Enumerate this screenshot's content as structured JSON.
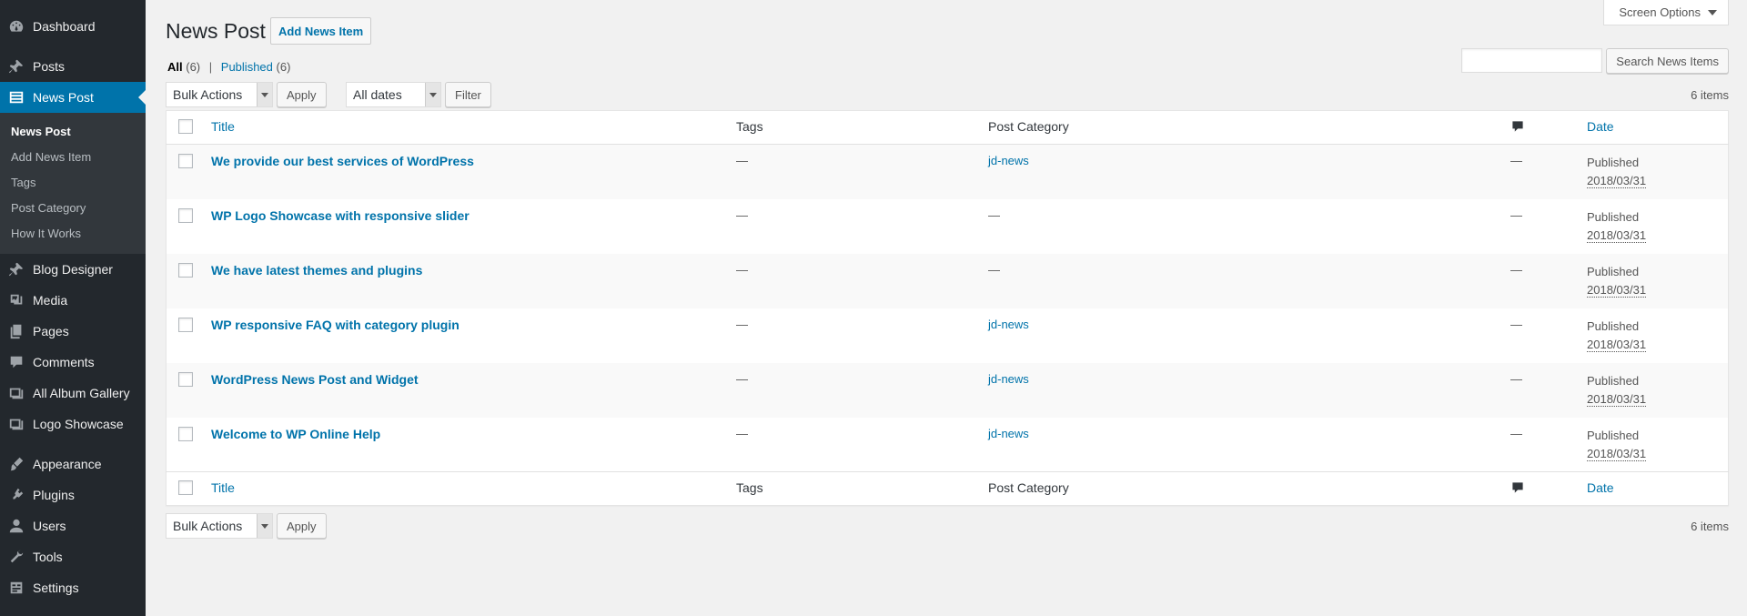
{
  "sidebar": {
    "items_top": [
      {
        "label": "Dashboard",
        "icon": "dashboard-icon"
      },
      {
        "label": "Posts",
        "icon": "pin-icon"
      }
    ],
    "current": {
      "label": "News Post",
      "icon": "list-icon"
    },
    "submenu": [
      "News Post",
      "Add News Item",
      "Tags",
      "Post Category",
      "How It Works"
    ],
    "items_mid": [
      {
        "label": "Blog Designer",
        "icon": "pin-icon"
      },
      {
        "label": "Media",
        "icon": "media-icon"
      },
      {
        "label": "Pages",
        "icon": "pages-icon"
      },
      {
        "label": "Comments",
        "icon": "comment-icon"
      },
      {
        "label": "All Album Gallery",
        "icon": "gallery-icon"
      },
      {
        "label": "Logo Showcase",
        "icon": "gallery-icon"
      }
    ],
    "items_bottom": [
      {
        "label": "Appearance",
        "icon": "brush-icon"
      },
      {
        "label": "Plugins",
        "icon": "plugin-icon"
      },
      {
        "label": "Users",
        "icon": "user-icon"
      },
      {
        "label": "Tools",
        "icon": "wrench-icon"
      },
      {
        "label": "Settings",
        "icon": "settings-icon"
      }
    ]
  },
  "header": {
    "screen_options": "Screen Options",
    "title": "News Post",
    "add_button": "Add News Item"
  },
  "filters": {
    "all_label": "All",
    "all_count": "(6)",
    "published_label": "Published",
    "published_count": "(6)",
    "separator": "|"
  },
  "search": {
    "button": "Search News Items",
    "value": ""
  },
  "tablenav": {
    "bulk_actions": "Bulk Actions",
    "apply": "Apply",
    "dates": "All dates",
    "filter": "Filter",
    "count": "6 items"
  },
  "table": {
    "columns": {
      "title": "Title",
      "tags": "Tags",
      "category": "Post Category",
      "comments_icon": "comment-icon",
      "date": "Date"
    },
    "rows": [
      {
        "title": "We provide our best services of WordPress",
        "tags": "—",
        "category": "jd-news",
        "comments": "—",
        "status": "Published",
        "date": "2018/03/31"
      },
      {
        "title": "WP Logo Showcase with responsive slider",
        "tags": "—",
        "category": "—",
        "comments": "—",
        "status": "Published",
        "date": "2018/03/31"
      },
      {
        "title": "We have latest themes and plugins",
        "tags": "—",
        "category": "—",
        "comments": "—",
        "status": "Published",
        "date": "2018/03/31"
      },
      {
        "title": "WP responsive FAQ with category plugin",
        "tags": "—",
        "category": "jd-news",
        "comments": "—",
        "status": "Published",
        "date": "2018/03/31"
      },
      {
        "title": "WordPress News Post and Widget",
        "tags": "—",
        "category": "jd-news",
        "comments": "—",
        "status": "Published",
        "date": "2018/03/31"
      },
      {
        "title": "Welcome to WP Online Help",
        "tags": "—",
        "category": "jd-news",
        "comments": "—",
        "status": "Published",
        "date": "2018/03/31"
      }
    ]
  },
  "colors": {
    "sidebar_bg": "#23282d",
    "accent": "#0073aa",
    "page_bg": "#f1f1f1"
  }
}
